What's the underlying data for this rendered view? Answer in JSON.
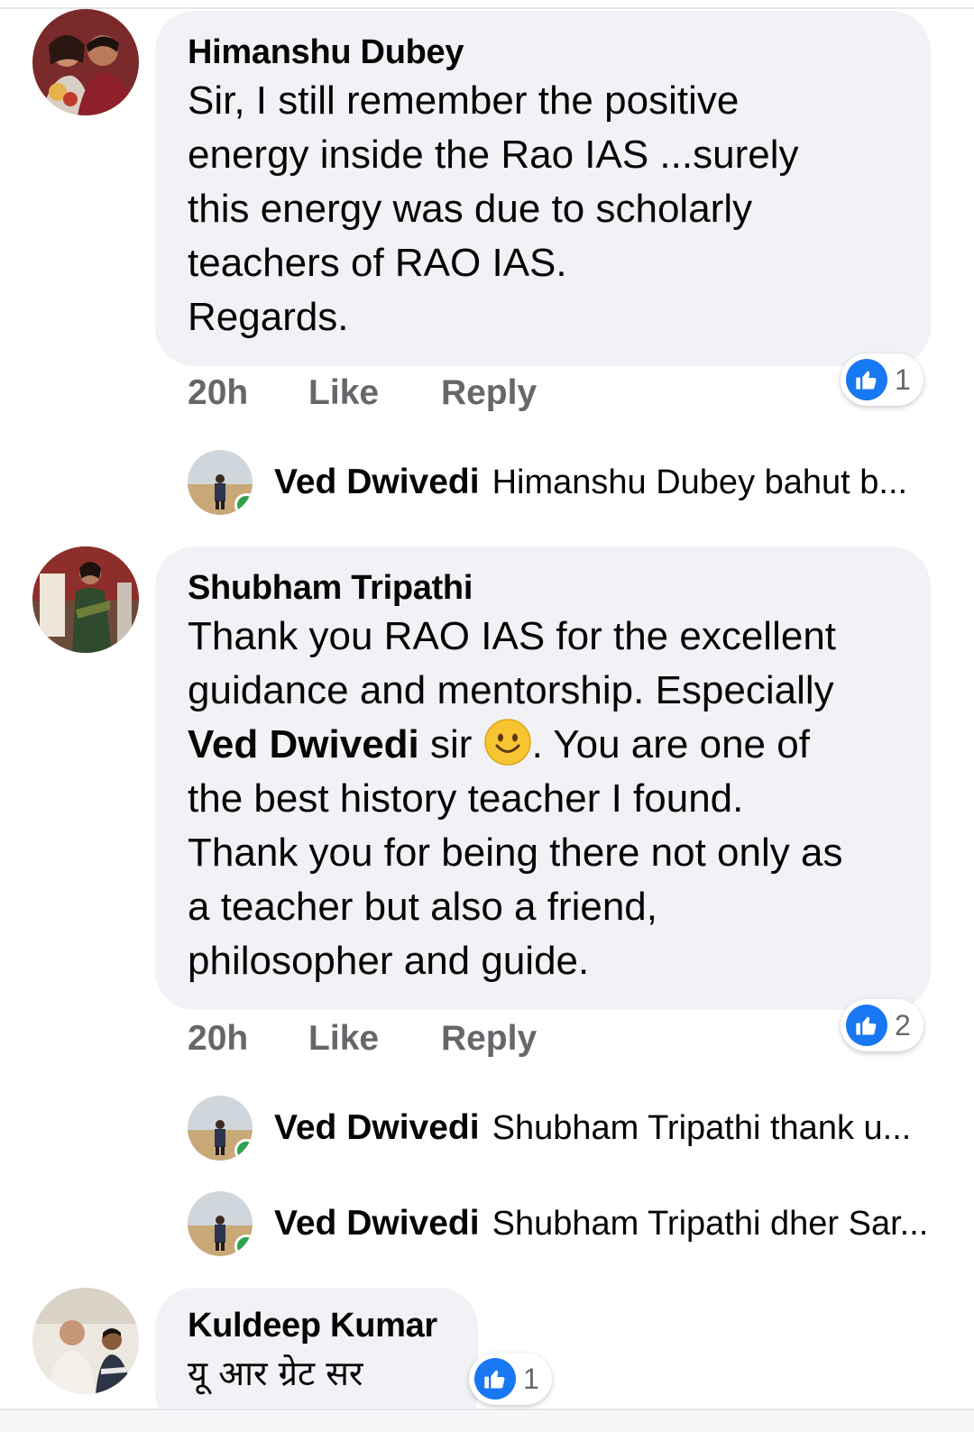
{
  "comments": [
    {
      "author": "Himanshu Dubey",
      "text": "Sir, I still remember the positive\nenergy inside the Rao IAS ...surely\nthis energy was due to scholarly\nteachers of RAO IAS.\nRegards.",
      "time": "20h",
      "like_label": "Like",
      "reply_label": "Reply",
      "reaction_count": "1",
      "replies": [
        {
          "author": "Ved Dwivedi",
          "preview": "Himanshu Dubey bahut b..."
        }
      ]
    },
    {
      "author": "Shubham Tripathi",
      "text_part1": "Thank you RAO  IAS for the excellent\nguidance and mentorship. Especially\n",
      "mention": "Ved Dwivedi",
      "text_part2": "  sir ",
      "text_part3": ". You are one of\nthe best history teacher I found.\nThank you for being there not only as\na teacher but also a friend,\nphilosopher and guide.",
      "time": "20h",
      "like_label": "Like",
      "reply_label": "Reply",
      "reaction_count": "2",
      "replies": [
        {
          "author": "Ved Dwivedi",
          "preview": "Shubham Tripathi thank u..."
        },
        {
          "author": "Ved Dwivedi",
          "preview": "Shubham Tripathi dher Sar..."
        }
      ]
    },
    {
      "author": "Kuldeep Kumar",
      "text": "यू आर ग्रेट सर",
      "reaction_count": "1"
    }
  ],
  "colors": {
    "bubble": "#f0f2f5",
    "like_blue": "#1877f2",
    "meta_gray": "#65676b",
    "online_green": "#31a24c"
  },
  "icons": {
    "reaction": "thumbs-up-icon",
    "emoji": "smiling-face-icon"
  }
}
